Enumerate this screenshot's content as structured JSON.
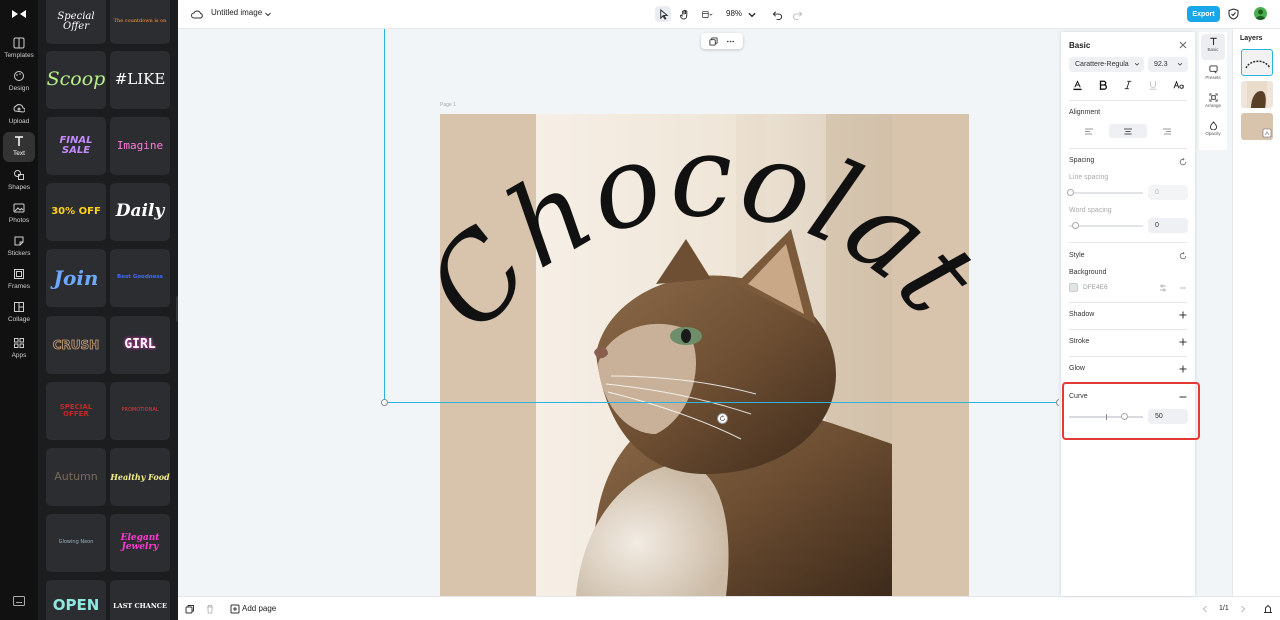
{
  "rail": {
    "items": [
      {
        "label": "Templates",
        "icon": "templates-icon"
      },
      {
        "label": "Design",
        "icon": "design-icon"
      },
      {
        "label": "Upload",
        "icon": "upload-icon"
      },
      {
        "label": "Text",
        "icon": "text-icon",
        "active": true
      },
      {
        "label": "Shapes",
        "icon": "shapes-icon"
      },
      {
        "label": "Photos",
        "icon": "photos-icon"
      },
      {
        "label": "Stickers",
        "icon": "stickers-icon"
      },
      {
        "label": "Frames",
        "icon": "frames-icon"
      },
      {
        "label": "Collage",
        "icon": "collage-icon"
      },
      {
        "label": "Apps",
        "icon": "apps-icon"
      }
    ]
  },
  "templates": [
    {
      "text": "Special Offer",
      "color": "#ffffff"
    },
    {
      "text": "The countdown is on",
      "color": "#ff9a3c"
    },
    {
      "text": "Scoop",
      "color": "#b8f08a"
    },
    {
      "text": "#LIKE",
      "color": "#ffffff"
    },
    {
      "text": "FINAL SALE",
      "color": "#c58bff"
    },
    {
      "text": "Imagine",
      "color": "#ff7ad9"
    },
    {
      "text": "30% OFF",
      "color": "#ffd21f"
    },
    {
      "text": "Daily",
      "color": "#ffffff"
    },
    {
      "text": "Join",
      "color": "#6ea8ff"
    },
    {
      "text": "Best Goodness",
      "color": "#3a6bff"
    },
    {
      "text": "CRUSH",
      "color": "#c9a27a"
    },
    {
      "text": "GIRL",
      "color": "#ffffff"
    },
    {
      "text": "SPECIAL OFFER",
      "color": "#c0282a"
    },
    {
      "text": "PROMOTIONAL",
      "color": "#e23a3a"
    },
    {
      "text": "Autumn",
      "color": "#7a6a5a"
    },
    {
      "text": "Healthy Food",
      "color": "#f3f08a"
    },
    {
      "text": "Glowing Neon",
      "color": "#9ab0c0"
    },
    {
      "text": "Elegant Jewelry",
      "color": "#ff3ad6"
    },
    {
      "text": "OPEN",
      "color": "#8ee8e0"
    },
    {
      "text": "LAST CHANCE",
      "color": "#ffffff"
    }
  ],
  "topbar": {
    "title": "Untitled image",
    "zoom": "98%",
    "export_label": "Export"
  },
  "canvas": {
    "page_label": "Page 1",
    "curved_text": "Chocolate",
    "background_color": "#D8C3AD"
  },
  "bottombar": {
    "add_page": "Add page",
    "pages": "1/1"
  },
  "props": {
    "header": "Basic",
    "font": "Carattere-Regula",
    "font_size": "92.3",
    "alignment_label": "Alignment",
    "spacing_label": "Spacing",
    "line_spacing_label": "Line spacing",
    "line_spacing_value": "0",
    "word_spacing_label": "Word spacing",
    "word_spacing_value": "0",
    "style_label": "Style",
    "background_label": "Background",
    "background_value": "DFE4E6",
    "shadow_label": "Shadow",
    "stroke_label": "Stroke",
    "glow_label": "Glow",
    "curve_label": "Curve",
    "curve_value": "50",
    "curve_fraction": 0.5
  },
  "side_tabs": [
    {
      "label": "Basic",
      "active": true
    },
    {
      "label": "Presets"
    },
    {
      "label": "Arrange"
    },
    {
      "label": "Opacity"
    }
  ],
  "layers": {
    "header": "Layers"
  },
  "colors": {
    "accent": "#18A7E8",
    "selection": "#2BB4DD",
    "highlight": "#E53935"
  }
}
